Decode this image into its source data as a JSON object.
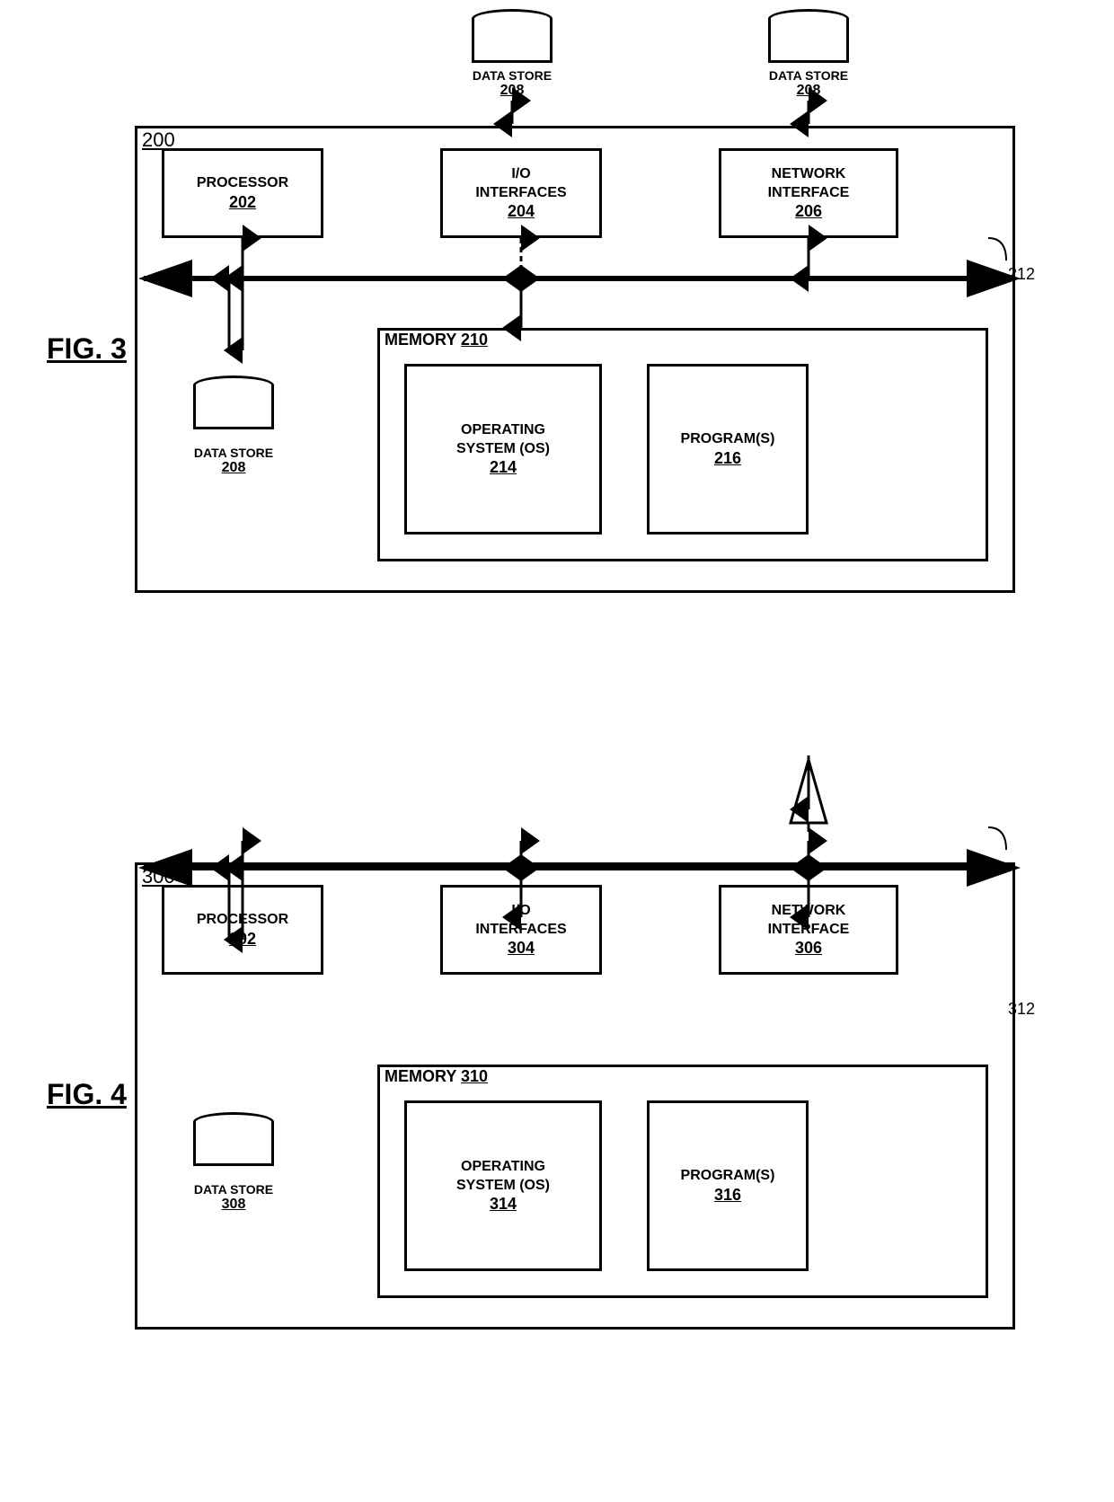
{
  "fig3": {
    "label": "FIG. 3",
    "box_200": {
      "id": "200",
      "processor": {
        "label": "PROCESSOR",
        "num": "202"
      },
      "io": {
        "label": "I/O\nINTERFACES",
        "num": "204"
      },
      "ni": {
        "label": "NETWORK\nINTERFACE",
        "num": "206"
      },
      "bus_label": "212",
      "memory": {
        "label": "MEMORY",
        "num": "210",
        "os": {
          "label": "OPERATING\nSYSTEM (OS)",
          "num": "214"
        },
        "programs": {
          "label": "PROGRAM(S)",
          "num": "216"
        }
      },
      "datastore_inside": {
        "label": "DATA STORE",
        "num": "208"
      }
    },
    "datastore_top1": {
      "label": "DATA STORE",
      "num": "208"
    },
    "datastore_top2": {
      "label": "DATA STORE",
      "num": "208"
    }
  },
  "fig4": {
    "label": "FIG. 4",
    "box_300": {
      "id": "300",
      "processor": {
        "label": "PROCESSOR",
        "num": "302"
      },
      "io": {
        "label": "I/O\nINTERFACES",
        "num": "304"
      },
      "ni": {
        "label": "NETWORK\nINTERFACE",
        "num": "306"
      },
      "bus_label": "312",
      "memory": {
        "label": "MEMORY",
        "num": "310",
        "os": {
          "label": "OPERATING\nSYSTEM (OS)",
          "num": "314"
        },
        "programs": {
          "label": "PROGRAM(S)",
          "num": "316"
        }
      },
      "datastore_inside": {
        "label": "DATA STORE",
        "num": "308"
      }
    }
  }
}
